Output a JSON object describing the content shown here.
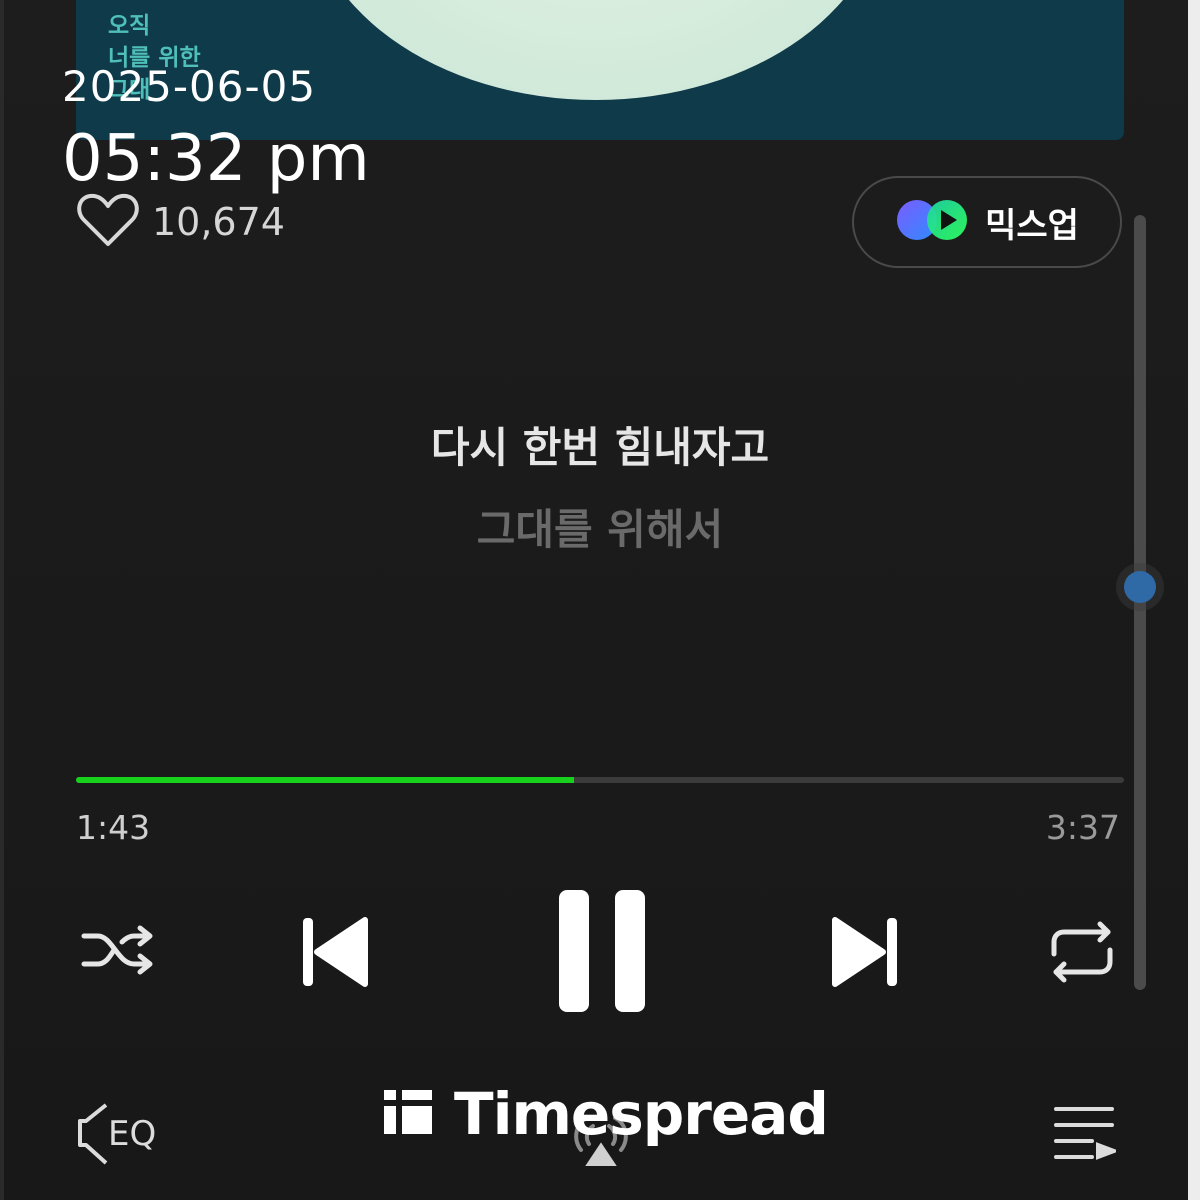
{
  "album": {
    "art_text": "오직\n너를 위한\n그대"
  },
  "overlay": {
    "date": "2025-06-05",
    "time": "05:32 pm"
  },
  "like": {
    "count": "10,674"
  },
  "mixup": {
    "label": "믹스업"
  },
  "lyrics": {
    "current": "다시 한번 힘내자고",
    "next": "그대를 위해서"
  },
  "player": {
    "elapsed": "1:43",
    "total": "3:37",
    "progress_fraction": 0.475,
    "accent": "#17d11d"
  },
  "scroll": {
    "position_fraction": 0.48
  },
  "bottom": {
    "eq_label": "EQ"
  },
  "brand": {
    "name": "Timespread"
  },
  "icons": {
    "like": "heart-icon",
    "mixup": "mixup-logo-icon",
    "shuffle": "shuffle-icon",
    "previous": "skip-previous-icon",
    "pause": "pause-icon",
    "next": "skip-next-icon",
    "repeat": "repeat-icon",
    "eq": "equalizer-icon",
    "cast": "cast-icon",
    "queue": "playlist-icon"
  }
}
